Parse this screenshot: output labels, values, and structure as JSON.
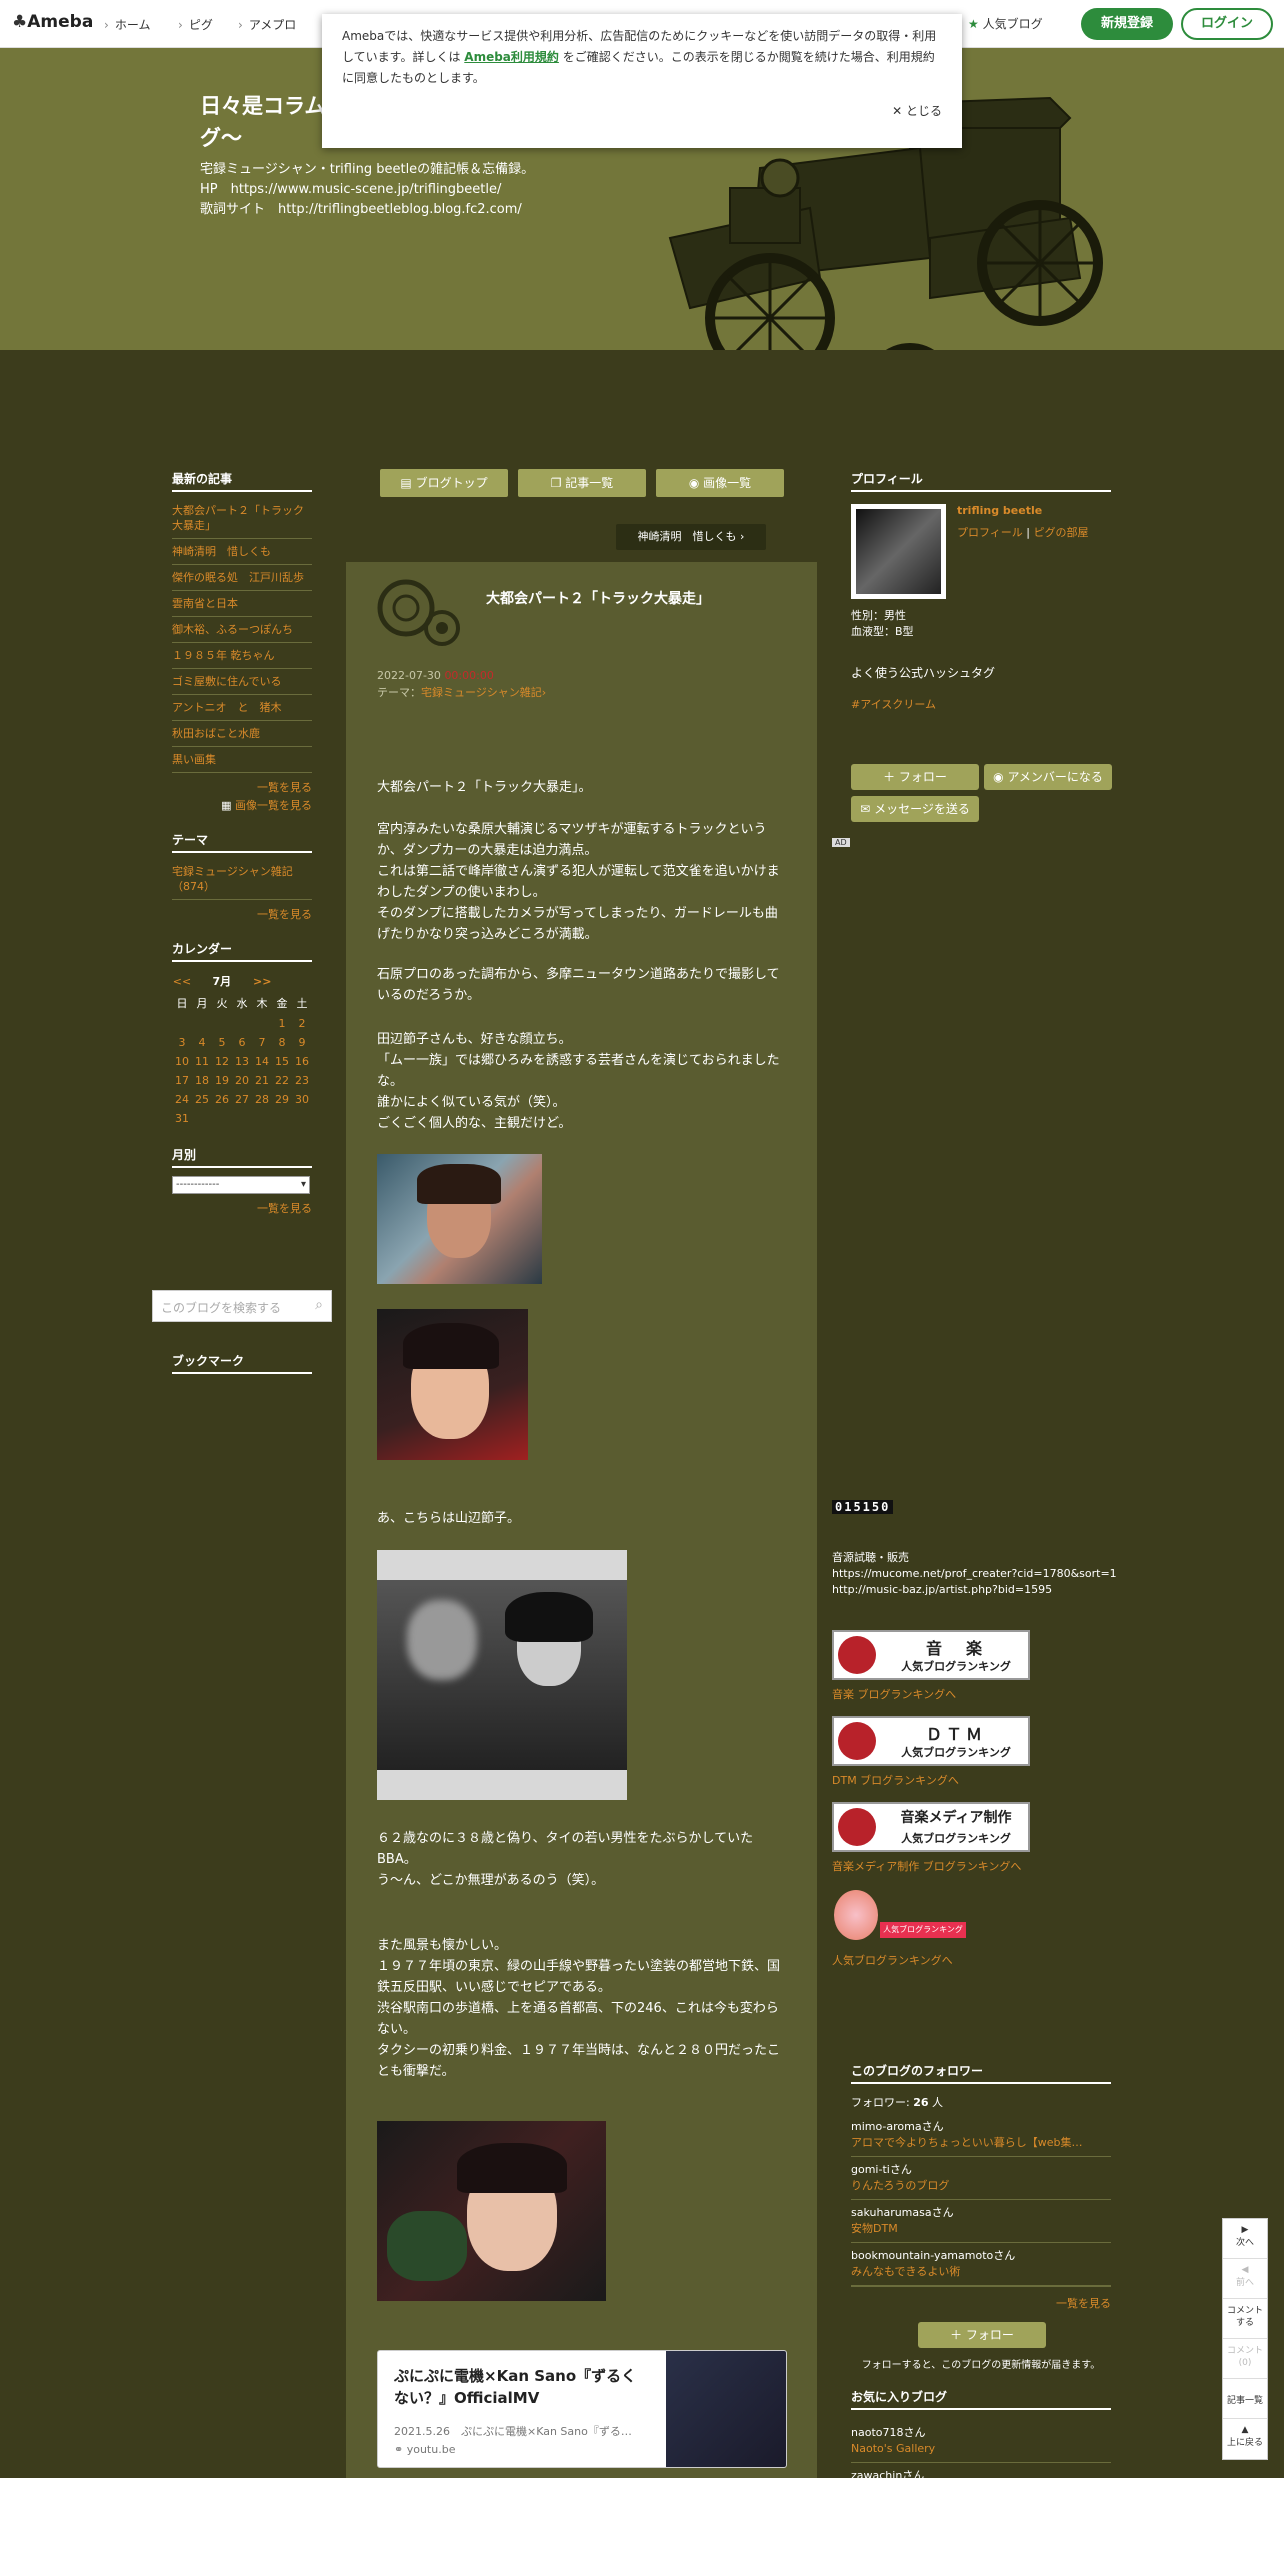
{
  "topbar": {
    "logo": "Ameba",
    "nav": [
      "ホーム",
      "ピグ",
      "アメプロ"
    ],
    "popular": "人気ブログ",
    "register": "新規登録",
    "login": "ログイン"
  },
  "cookie": {
    "text_1": "Amebaでは、快適なサービス提供や利用分析、広告配信のためにクッキーなどを使い訪問データの取得・利用しています。詳しくは",
    "link": "Ameba利用規約",
    "text_2": "をご確認ください。この表示を閉じるか閲覧を続けた場合、利用規約に同意したものとします。",
    "close": "とじる"
  },
  "header": {
    "title": "日々是コラムグ～",
    "desc": [
      "宅録ミュージシャン・trifling beetleの雑記帳＆忘備録。",
      "HP　https://www.music-scene.jp/triflingbeetle/",
      "歌詞サイト　http://triflingbeetleblog.blog.fc2.com/"
    ]
  },
  "left": {
    "recent_h": "最新の記事",
    "recent": [
      "大都会パート２「トラック大暴走」",
      "神崎清明　惜しくも",
      "傑作の眠る処　江戸川乱歩",
      "雲南省と日本",
      "御木裕、ふるーつぽんち",
      "１９８５年 乾ちゃん",
      "ゴミ屋敷に住んでいる",
      "アントニオ　と　猪木",
      "秋田おばこと水鹿",
      "黒い画集"
    ],
    "more": "一覧を見る",
    "img_list": "画像一覧を見る",
    "theme_h": "テーマ",
    "theme": "宅録ミュージシャン雑記（874）",
    "cal_h": "カレンダー",
    "cal_prev": "<<",
    "cal_month": "7月",
    "cal_next": ">>",
    "days": [
      "日",
      "月",
      "火",
      "水",
      "木",
      "金",
      "土"
    ],
    "weeks": [
      [
        "",
        "",
        "",
        "",
        "",
        "1",
        "2"
      ],
      [
        "3",
        "4",
        "5",
        "6",
        "7",
        "8",
        "9"
      ],
      [
        "10",
        "11",
        "12",
        "13",
        "14",
        "15",
        "16"
      ],
      [
        "17",
        "18",
        "19",
        "20",
        "21",
        "22",
        "23"
      ],
      [
        "24",
        "25",
        "26",
        "27",
        "28",
        "29",
        "30"
      ],
      [
        "31",
        "",
        "",
        "",
        "",
        "",
        ""
      ]
    ],
    "monthly_h": "月別",
    "monthly_sel": "------------",
    "search_ph": "このブログを検索する",
    "bookmark_h": "ブックマーク"
  },
  "main": {
    "btn_top": "ブログトップ",
    "btn_list": "記事一覧",
    "btn_imgs": "画像一覧",
    "next": "神崎清明　惜しくも",
    "title": "大都会パート２「トラック大暴走」",
    "date": "2022-07-30",
    "time": "00:00:00",
    "theme_label": "テーマ：",
    "theme": "宅録ミュージシャン雑記",
    "p1": "大都会パート２「トラック大暴走」。",
    "p2": "宮内淳みたいな桑原大輔演じるマツザキが運転するトラックというか、ダンプカーの大暴走は迫力満点。",
    "p3": "これは第二話で峰岸徹さん演ずる犯人が運転して范文雀を追いかけまわしたダンプの使いまわし。",
    "p4": "そのダンプに搭載したカメラが写ってしまったり、ガードレールも曲げたりかなり突っ込みどころが満載。",
    "p5": "石原プロのあった調布から、多摩ニュータウン道路あたりで撮影しているのだろうか。",
    "p6": "田辺節子さんも、好きな顔立ち。",
    "p7": "「ムー一族」では郷ひろみを誘惑する芸者さんを演じておられましたな。",
    "p8": "誰かによく似ている気が（笑）。",
    "p9": "ごくごく個人的な、主観だけど。",
    "p10": "あ、こちらは山辺節子。",
    "p11": "６２歳なのに３８歳と偽り、タイの若い男性をたぶらかしていたBBA。",
    "p12": "う～ん、どこか無理があるのう（笑）。",
    "p13": "また風景も懐かしい。",
    "p14": "１９７７年頃の東京、緑の山手線や野暮ったい塗装の都営地下鉄、国鉄五反田駅、いい感じでセピアである。",
    "p15": "渋谷駅南口の歩道橋、上を通る首都高、下の246、これは今も変わらない。",
    "p16": "タクシーの初乗り料金、１９７７年当時は、なんと２８０円だったことも衝撃だ。",
    "card_title": "ぷにぷに電機×Kan Sano『ずるくない？』OfficialMV",
    "card_date": "2021.5.26",
    "card_desc": "ぷにぷに電機×Kan Sano『ずる…",
    "card_domain": "youtu.be"
  },
  "right": {
    "profile_h": "プロフィール",
    "name": "trifling beetle",
    "profile_link": "プロフィール",
    "pig_link": "ピグの部屋",
    "sex": "性別：男性",
    "blood": "血液型：B型",
    "hashtag_h": "よく使う公式ハッシュタグ",
    "hashtag": "#アイスクリーム",
    "follow": "フォロー",
    "member": "アメンバーになる",
    "message": "メッセージを送る",
    "ad": "AD",
    "counter": "015150",
    "sales_h": "音源試聴・販売",
    "sales_1": "https://mucome.net/prof_creater?cid=1780&sort=1",
    "sales_2": "http://music-baz.jp/artist.php?bid=1595",
    "rank": [
      {
        "big": "音　楽",
        "small": "人気ブログランキング",
        "link": "音楽 ブログランキングへ"
      },
      {
        "big": "ＤＴＭ",
        "small": "人気ブログランキング",
        "link": "DTM ブログランキングへ"
      },
      {
        "big": "音楽メディア制作",
        "small": "人気ブログランキング",
        "link": "音楽メディア制作 ブログランキングへ"
      }
    ],
    "rank4_label": "人気ブログランキング",
    "rank4_link": "人気ブログランキングへ",
    "followers_h": "このブログのフォロワー",
    "followers_label": "フォロワー:",
    "followers_count": "26",
    "followers_unit": "人",
    "followers": [
      {
        "user": "mimo-aromaさん",
        "blog": "アロマで今よりちょっといい暮らし【web集…"
      },
      {
        "user": "gomi-tiさん",
        "blog": "りんたろうのブログ"
      },
      {
        "user": "sakuharumasaさん",
        "blog": "安物DTM"
      },
      {
        "user": "bookmountain-yamamotoさん",
        "blog": "みんなもできるよい術"
      }
    ],
    "more": "一覧を見る",
    "follow2": "フォロー",
    "follow_note": "フォローすると、このブログの更新情報が届きます。",
    "fav_h": "お気に入りブログ",
    "favs": [
      {
        "user": "naoto718さん",
        "blog": "Naoto's Gallery"
      },
      {
        "user": "zawachinさん",
        "blog": ""
      }
    ]
  },
  "floatnav": {
    "next": "次へ",
    "prev": "前へ",
    "comment": "コメントする",
    "comment2": "コメント(0)",
    "list": "記事一覧",
    "top": "上に戻る"
  }
}
